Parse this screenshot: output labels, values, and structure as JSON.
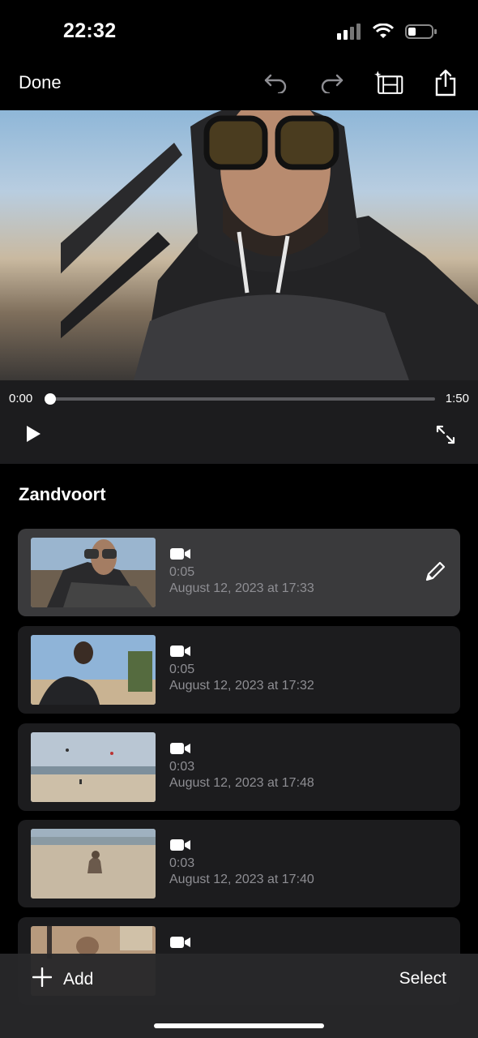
{
  "status": {
    "time": "22:32"
  },
  "toolbar": {
    "done_label": "Done"
  },
  "player": {
    "time_start": "0:00",
    "time_end": "1:50",
    "progress": 0
  },
  "section": {
    "title": "Zandvoort"
  },
  "clips": [
    {
      "duration": "0:05",
      "date": "August 12, 2023 at 17:33",
      "selected": true
    },
    {
      "duration": "0:05",
      "date": "August 12, 2023 at 17:32",
      "selected": false
    },
    {
      "duration": "0:03",
      "date": "August 12, 2023 at 17:48",
      "selected": false
    },
    {
      "duration": "0:03",
      "date": "August 12, 2023 at 17:40",
      "selected": false
    },
    {
      "duration": "",
      "date": "",
      "selected": false
    }
  ],
  "bottom": {
    "add_label": "Add",
    "select_label": "Select"
  },
  "icons": [
    "signal-icon",
    "wifi-icon",
    "battery-icon",
    "undo-icon",
    "redo-icon",
    "magic-movie-icon",
    "share-icon",
    "play-icon",
    "fullscreen-icon",
    "video-camera-icon",
    "pencil-icon",
    "plus-icon"
  ]
}
